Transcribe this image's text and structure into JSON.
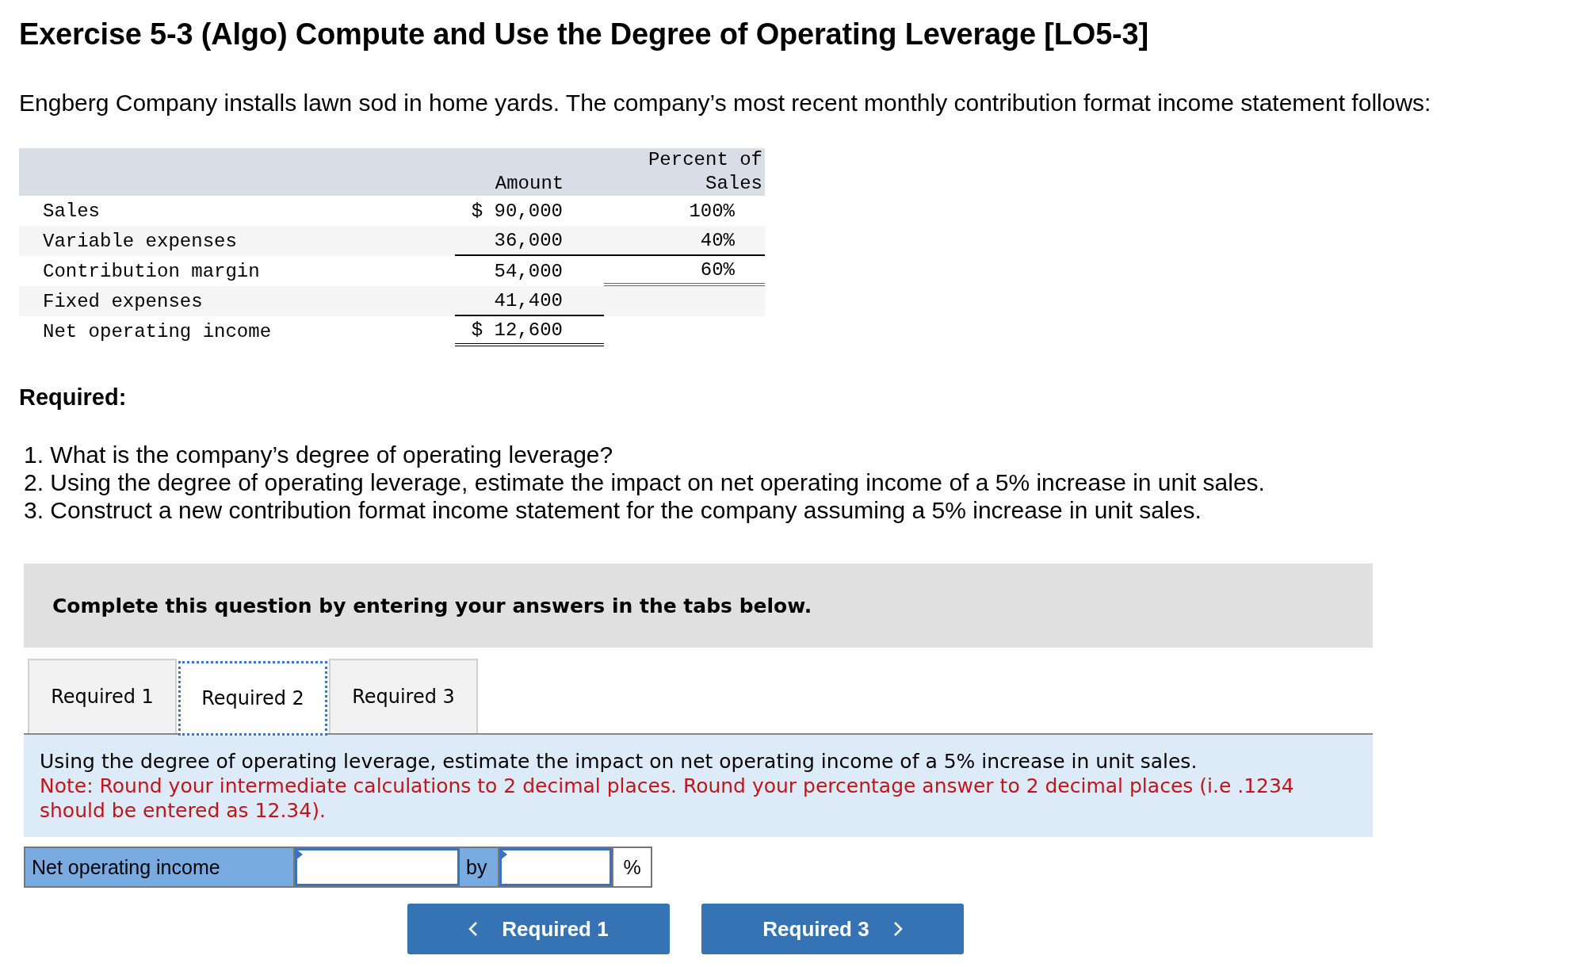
{
  "title": "Exercise 5-3 (Algo) Compute and Use the Degree of Operating Leverage [LO5-3]",
  "intro": "Engberg Company installs lawn sod in home yards. The company’s most recent monthly contribution format income statement follows:",
  "statement": {
    "columns": [
      "Amount",
      "Percent of Sales"
    ],
    "rows": [
      {
        "label": "Sales",
        "amount": "$ 90,000",
        "percent": "100%"
      },
      {
        "label": "Variable expenses",
        "amount": "36,000",
        "percent": "40%"
      },
      {
        "label": "Contribution margin",
        "amount": "54,000",
        "percent": "60%"
      },
      {
        "label": "Fixed expenses",
        "amount": "41,400"
      },
      {
        "label": "Net operating income",
        "amount": "$ 12,600"
      }
    ]
  },
  "required": {
    "heading": "Required:",
    "items": [
      "1. What is the company’s degree of operating leverage?",
      "2. Using the degree of operating leverage, estimate the impact on net operating income of a 5% increase in unit sales.",
      "3. Construct a new contribution format income statement for the company assuming a 5% increase in unit sales."
    ]
  },
  "instruction": "Complete this question by entering your answers in the tabs below.",
  "tabs": [
    {
      "label": "Required 1",
      "selected": false
    },
    {
      "label": "Required 2",
      "selected": true
    },
    {
      "label": "Required 3",
      "selected": false
    }
  ],
  "panel": {
    "text": "Using the degree of operating leverage, estimate the impact on net operating income of a 5% increase in unit sales.",
    "note": "Note: Round your intermediate calculations to 2 decimal places. Round your percentage answer to 2 decimal places (i.e .1234 should be entered as 12.34)."
  },
  "answer_row": [
    {
      "kind": "label",
      "text": "Net operating income"
    },
    {
      "kind": "input"
    },
    {
      "kind": "label",
      "text": "by"
    },
    {
      "kind": "input"
    },
    {
      "kind": "unit",
      "text": "%"
    }
  ],
  "nav": [
    {
      "kind": "prev",
      "label": "Required 1"
    },
    {
      "kind": "next",
      "label": "Required 3"
    }
  ]
}
